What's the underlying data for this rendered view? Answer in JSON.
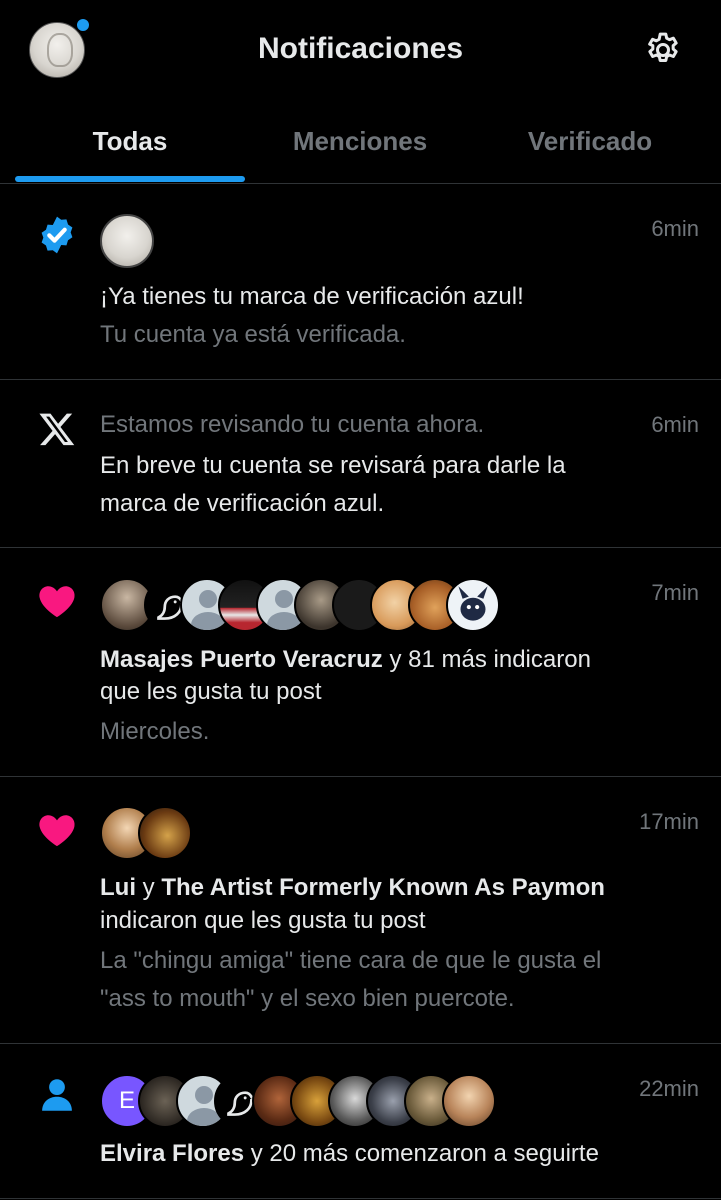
{
  "header": {
    "title": "Notificaciones"
  },
  "tabs": [
    {
      "label": "Todas",
      "active": true
    },
    {
      "label": "Menciones",
      "active": false
    },
    {
      "label": "Verificado",
      "active": false
    }
  ],
  "colors": {
    "accent": "#1d9bf0",
    "like": "#f91880",
    "muted": "#71767b",
    "text": "#e7e9ea",
    "background": "#000000"
  },
  "notifications": [
    {
      "icon": "verified-badge-icon",
      "time": "6min",
      "title": "¡Ya tienes tu marca de verificación azul!",
      "subtitle": "Tu cuenta ya está verificada."
    },
    {
      "icon": "x-logo-icon",
      "time": "6min",
      "title": "Estamos revisando tu cuenta ahora.",
      "body_line1": "En breve tu cuenta se revisará para darle la",
      "body_line2": "marca de verificación azul."
    },
    {
      "icon": "heart-icon",
      "time": "7min",
      "actor": "Masajes Puerto Veracruz",
      "rest_line1": " y 81 más indicaron",
      "rest_line2": "que les gusta tu post",
      "snippet": "Miercoles."
    },
    {
      "icon": "heart-icon",
      "time": "17min",
      "actor1": "Lui",
      "joiner": " y ",
      "actor2": "The Artist Formerly Known As Paymon",
      "rest_line2": "indicaron que les gusta tu post",
      "snippet_line1": "La \"chingu amiga\" tiene cara de que le gusta el",
      "snippet_line2": "\"ass to mouth\" y el sexo bien puercote."
    },
    {
      "icon": "person-icon",
      "time": "22min",
      "avatar_letter": "E",
      "actor": "Elvira Flores",
      "rest_line1": " y 20 más comenzaron a seguirte"
    }
  ]
}
